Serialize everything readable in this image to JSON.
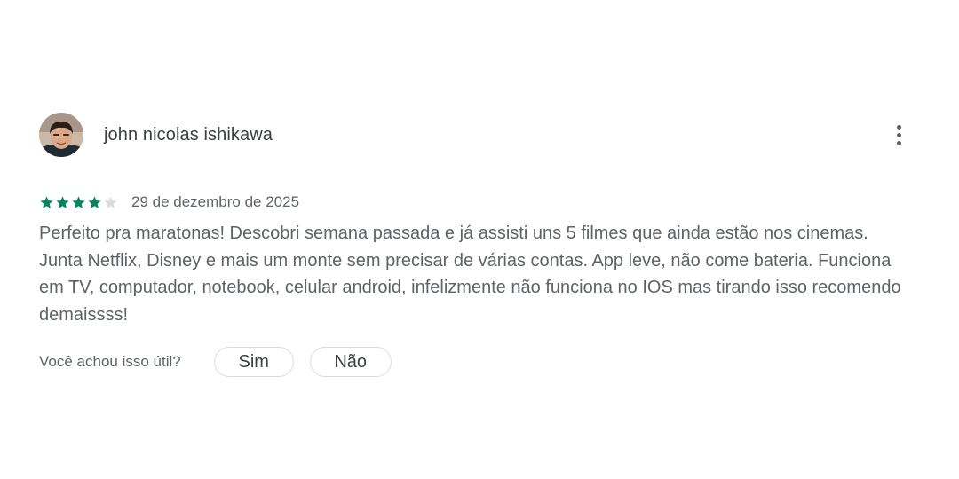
{
  "review": {
    "author": "john nicolas ishikawa",
    "rating": 4,
    "max_rating": 5,
    "star_color_filled": "#01875f",
    "star_color_empty": "#dadce0",
    "date": "29 de dezembro de 2025",
    "text": "Perfeito pra maratonas! Descobri semana passada e já assisti uns 5 filmes que ainda estão nos cinemas. Junta Netflix, Disney e mais um monte sem precisar de várias contas. App leve, não come bateria. Funciona em TV, computador, notebook, celular android, infelizmente não funciona no IOS mas tirando isso recomendo demaissss!"
  },
  "menu": {
    "icon": "more-vert-icon"
  },
  "helpful": {
    "question": "Você achou isso útil?",
    "yes_label": "Sim",
    "no_label": "Não"
  }
}
